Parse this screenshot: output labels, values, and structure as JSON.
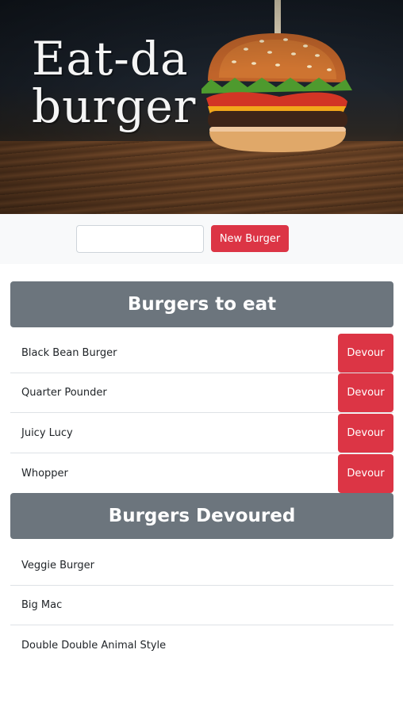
{
  "hero": {
    "title_line1": "Eat-da",
    "title_line2": "burger"
  },
  "form": {
    "input_value": "",
    "button_label": "New Burger"
  },
  "to_eat": {
    "heading": "Burgers to eat",
    "action_label": "Devour",
    "items": [
      "Black Bean Burger",
      "Quarter Pounder",
      "Juicy Lucy",
      "Whopper"
    ]
  },
  "devoured": {
    "heading": "Burgers Devoured",
    "items": [
      "Veggie Burger",
      "Big Mac",
      "Double Double Animal Style"
    ]
  },
  "colors": {
    "danger": "#dc3545",
    "header_gray": "#6c757d",
    "form_bg": "#f8f9fa"
  }
}
